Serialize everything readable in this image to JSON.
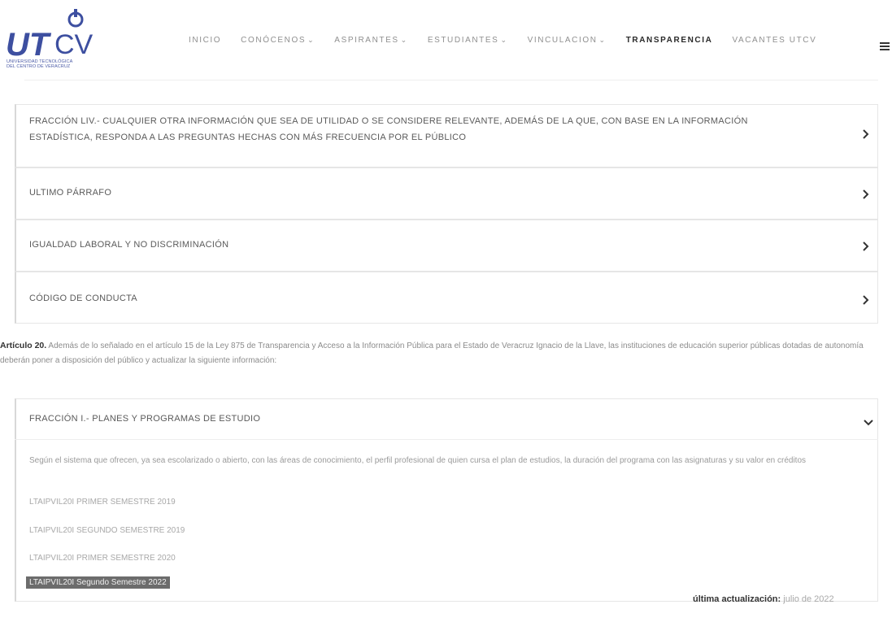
{
  "logo": {
    "text_ut": "UT",
    "text_cv": "CV",
    "subtitle_line1": "UNIVERSIDAD TECNOLÓGICA",
    "subtitle_line2": "DEL CENTRO DE VERACRUZ"
  },
  "nav": {
    "items": [
      {
        "label": "INICIO",
        "chevron": false
      },
      {
        "label": "CONÓCENOS",
        "chevron": true
      },
      {
        "label": "ASPIRANTES",
        "chevron": true
      },
      {
        "label": "ESTUDIANTES",
        "chevron": true
      },
      {
        "label": "VINCULACION",
        "chevron": true
      },
      {
        "label": "TRANSPARENCIA",
        "chevron": false
      },
      {
        "label": "VACANTES UTCV",
        "chevron": false
      }
    ],
    "chevron_glyph": "⌄"
  },
  "accordion": [
    {
      "title_line1": "FRACCIÓN LIV.- CUALQUIER OTRA INFORMACIÓN QUE SEA DE UTILIDAD O SE CONSIDERE RELEVANTE, ADEMÁS DE LA QUE, CON BASE EN LA INFORMACIÓN",
      "title_line2": "ESTADÍSTICA, RESPONDA A LAS PREGUNTAS HECHAS CON MÁS FRECUENCIA POR EL PÚBLICO"
    },
    {
      "title_line1": "ULTIMO PÁRRAFO",
      "title_line2": ""
    },
    {
      "title_line1": "IGUALDAD LABORAL Y NO DISCRIMINACIÓN",
      "title_line2": ""
    },
    {
      "title_line1": "CÓDIGO DE CONDUCTA",
      "title_line2": ""
    }
  ],
  "article": {
    "label": "Artículo 20.",
    "text": "Además de lo señalado en el artículo 15 de la Ley 875 de Transparencia y Acceso a la Información Pública para el Estado de Veracruz Ignacio de la Llave, las instituciones de educación superior públicas dotadas de autonomía deberán poner a disposición del público y actualizar la siguiente información:"
  },
  "open_section": {
    "title": "FRACCIÓN I.- PLANES Y PROGRAMAS DE ESTUDIO",
    "description": "Según el sistema que ofrecen, ya sea escolarizado o abierto, con las áreas de conocimiento, el perfil profesional de quien cursa el plan de estudios, la duración del programa con las asignaturas y su valor en créditos",
    "links": [
      "LTAIPVIL20I PRIMER SEMESTRE 2019",
      "LTAIPVIL20I SEGUNDO SEMESTRE 2019",
      "LTAIPVIL20I PRIMER SEMESTRE 2020",
      "LTAIPVIL20I Segundo Semestre 2022"
    ]
  },
  "updated": {
    "label": "última actualización:",
    "value": "julio de 2022"
  },
  "colors": {
    "logo_blue": "#3d4fa0",
    "text_gray": "#8c8c8c",
    "highlight_bg": "#6c6c6c"
  }
}
